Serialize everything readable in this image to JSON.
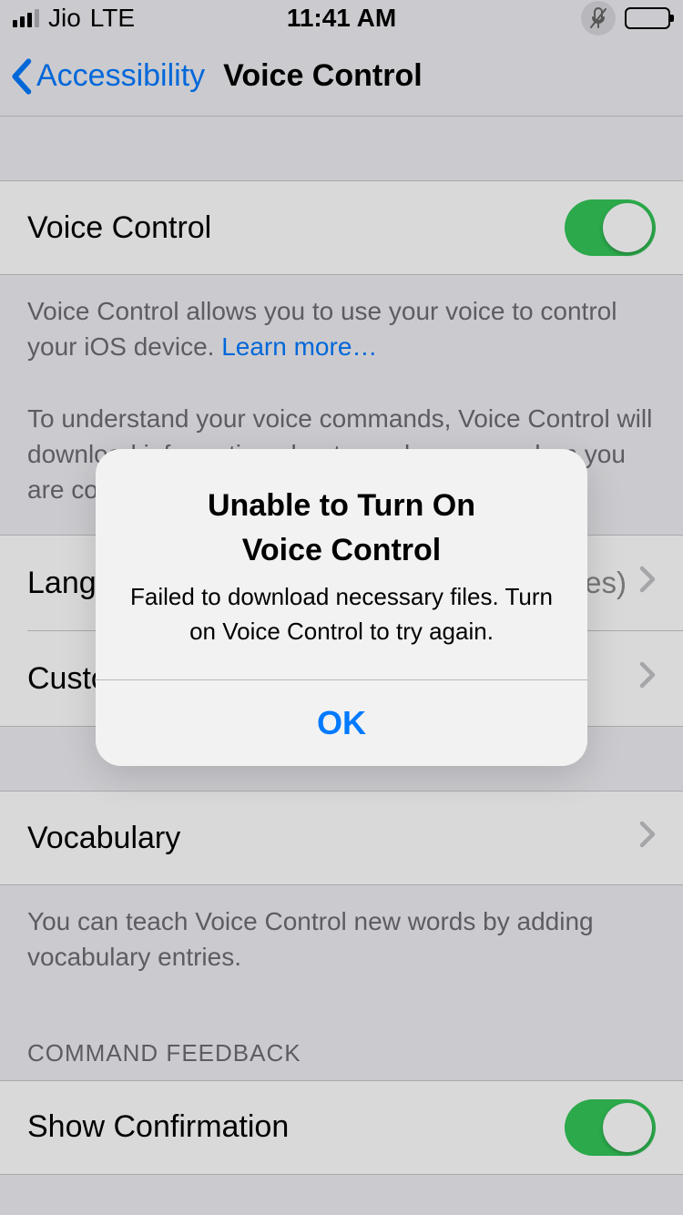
{
  "status_bar": {
    "carrier": "Jio",
    "network": "LTE",
    "time": "11:41 AM"
  },
  "nav": {
    "back_label": "Accessibility",
    "title": "Voice Control"
  },
  "rows": {
    "voice_control_label": "Voice Control",
    "voice_control_on": true,
    "language_label": "Language",
    "language_value": "English (United States)",
    "customize_label": "Customize Commands",
    "vocabulary_label": "Vocabulary",
    "show_confirmation_label": "Show Confirmation",
    "show_confirmation_on": true
  },
  "footers": {
    "vc_desc_1": "Voice Control allows you to use your voice to control your iOS device. ",
    "learn_more": "Learn more…",
    "vc_desc_2": "To understand your voice commands, Voice Control will download information about your language when you are connected to Wi-Fi.",
    "vocab_desc": "You can teach Voice Control new words by adding vocabulary entries."
  },
  "section_headers": {
    "command_feedback": "COMMAND FEEDBACK"
  },
  "alert": {
    "title_line1": "Unable to Turn On",
    "title_line2": "Voice Control",
    "message": "Failed to download necessary files. Turn on Voice Control to try again.",
    "ok": "OK"
  }
}
